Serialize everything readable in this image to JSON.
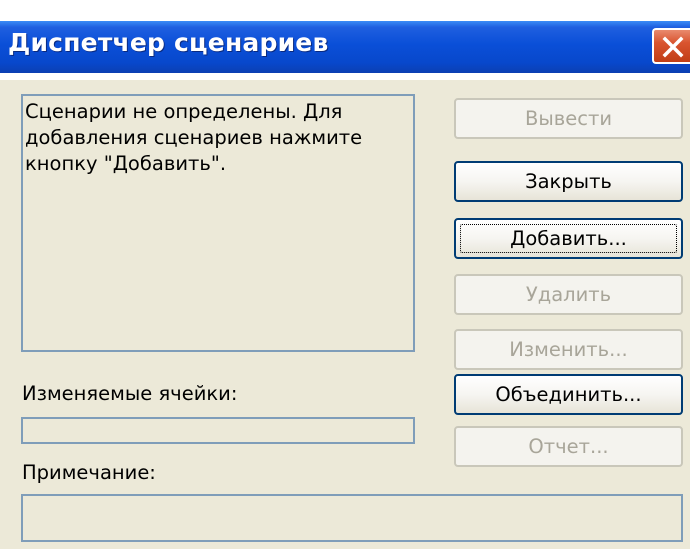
{
  "window": {
    "title": "Диспетчер сценариев",
    "close_icon": "close-icon"
  },
  "scenarios": {
    "empty_message": "Сценарии не определены. Для\nдобавления сценариев нажмите\nкнопку \"Добавить\"."
  },
  "changing_cells": {
    "label": "Изменяемые ячейки:",
    "value": ""
  },
  "comment": {
    "label": "Примечание:",
    "value": ""
  },
  "buttons": {
    "show": "Вывести",
    "close": "Закрыть",
    "add": "Добавить...",
    "delete": "Удалить",
    "edit": "Изменить...",
    "merge": "Объединить...",
    "summary": "Отчет..."
  },
  "colors": {
    "titlebar": "#0a4fd8",
    "close_button": "#d9542f",
    "dialog_background": "#ece9d8",
    "field_border": "#7f9db9",
    "disabled_text": "#a8a599"
  }
}
